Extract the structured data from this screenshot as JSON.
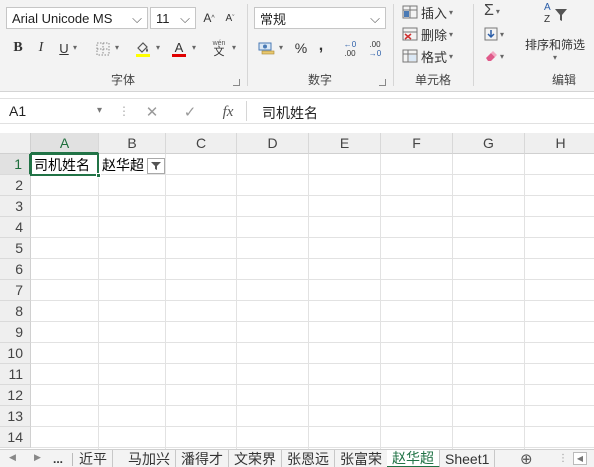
{
  "ribbon": {
    "font": {
      "font_name": "Arial Unicode MS",
      "font_size": "11",
      "grow_icon": "A",
      "shrink_icon": "A",
      "bold": "B",
      "italic": "I",
      "underline": "U",
      "phonetic_top": "wén",
      "phonetic_bottom": "文",
      "group_label": "字体"
    },
    "number": {
      "format": "常规",
      "percent": "%",
      "comma": ",",
      "inc_decimal_top": "←0",
      "inc_decimal_bottom": ".00",
      "dec_decimal_top": ".00",
      "dec_decimal_bottom": "→0",
      "group_label": "数字"
    },
    "cells": {
      "insert": "插入",
      "delete": "删除",
      "format": "格式",
      "group_label": "单元格"
    },
    "editing": {
      "sort_filter": "排序和筛选",
      "sort_icon_top": "A",
      "sort_icon_bottom": "Z",
      "group_label": "编辑"
    },
    "colors": {
      "highlight": "#ffff00",
      "font_color": "#e00000"
    }
  },
  "formula_bar": {
    "name_box": "A1",
    "cancel_icon": "✕",
    "enter_icon": "✓",
    "fx_icon": "fx",
    "content": "司机姓名"
  },
  "grid": {
    "columns": [
      "A",
      "B",
      "C",
      "D",
      "E",
      "F",
      "G",
      "H"
    ],
    "rows": [
      "1",
      "2",
      "3",
      "4",
      "5",
      "6",
      "7",
      "8",
      "9",
      "10",
      "11",
      "12",
      "13",
      "14"
    ],
    "cells": {
      "A1": "司机姓名",
      "B1": "赵华超"
    },
    "selected_cell": "A1"
  },
  "sheets": {
    "ellipsis": "...",
    "tabs": [
      "近平",
      "马加兴",
      "潘得才",
      "文荣界",
      "张恩远",
      "张富荣",
      "赵华超",
      "Sheet1"
    ],
    "active": "赵华超",
    "add_icon": "⊕"
  }
}
